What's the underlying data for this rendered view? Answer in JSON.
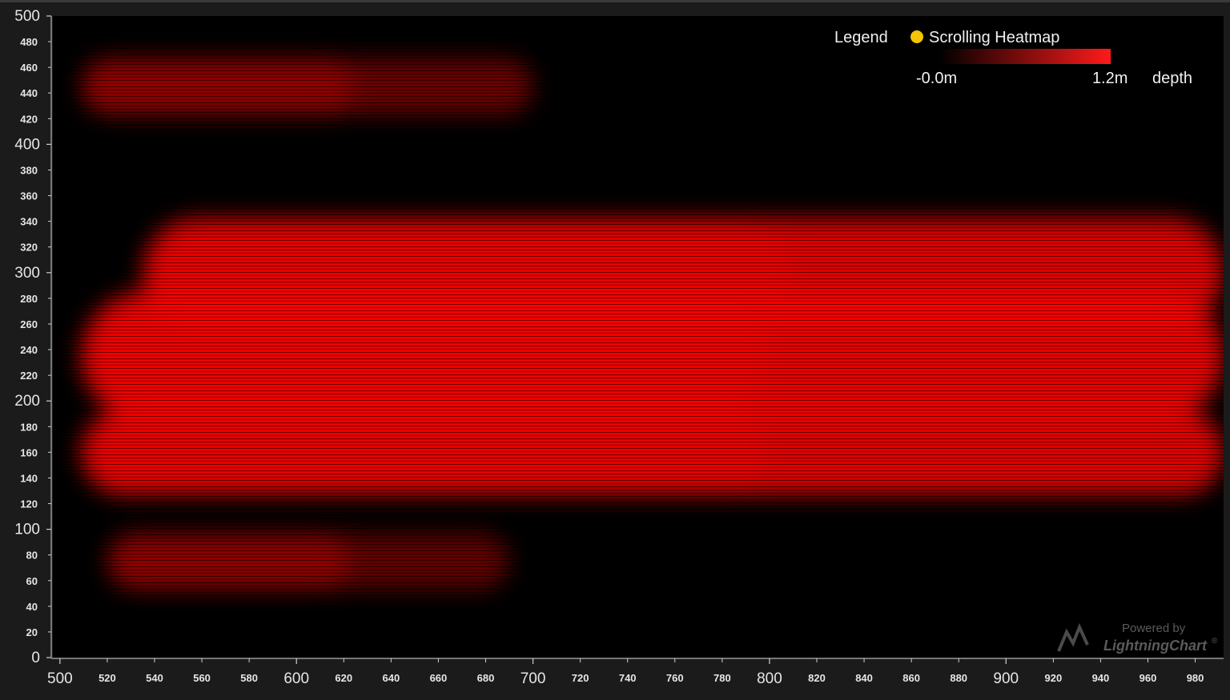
{
  "chart_data": {
    "type": "heatmap",
    "title": "",
    "xlabel": "",
    "ylabel": "",
    "xlim": [
      497,
      992
    ],
    "ylim": [
      0,
      500
    ],
    "x_ticks_major": [
      500,
      600,
      700,
      800,
      900
    ],
    "x_ticks_minor": [
      520,
      540,
      560,
      580,
      620,
      640,
      660,
      680,
      720,
      740,
      760,
      780,
      820,
      840,
      860,
      880,
      920,
      940,
      960,
      980
    ],
    "y_ticks_major": [
      0,
      100,
      200,
      300,
      400,
      500
    ],
    "y_ticks_minor": [
      20,
      40,
      60,
      80,
      120,
      140,
      160,
      180,
      220,
      240,
      260,
      280,
      320,
      340,
      360,
      380,
      420,
      440,
      460,
      480
    ],
    "data_x_start": 509,
    "grid": false,
    "series_name": "Scrolling Heatmap",
    "value_unit": "depth",
    "value_range": [
      0.0,
      1.2
    ],
    "palette": {
      "min_color": "#000000",
      "max_color": "#ff0000"
    },
    "bands": [
      {
        "y": 445,
        "half_width": 22,
        "value": 0.9,
        "x_extent": [
          509,
          700
        ],
        "tail": 0.55
      },
      {
        "y": 300,
        "half_width": 42,
        "value": 1.05,
        "x_extent": [
          535,
          992
        ],
        "tail": 1.0
      },
      {
        "y": 235,
        "half_width": 50,
        "value": 1.15,
        "x_extent": [
          509,
          992
        ],
        "tail": 0.95
      },
      {
        "y": 160,
        "half_width": 33,
        "value": 1.05,
        "x_extent": [
          509,
          992
        ],
        "tail": 1.0
      },
      {
        "y": 75,
        "half_width": 22,
        "value": 1.0,
        "x_extent": [
          520,
          690
        ],
        "tail": 0.45
      }
    ]
  },
  "legend": {
    "title": "Legend",
    "series_label": "Scrolling Heatmap",
    "marker_color": "#f2c500",
    "min_label": "-0.0m",
    "max_label": "1.2m",
    "unit_label": "depth",
    "gradient_start": "#000000",
    "gradient_end": "#ff1a1a"
  },
  "watermark": {
    "line1": "Powered by",
    "line2": "LightningChart",
    "mark": "®"
  },
  "colors": {
    "background": "#1b1b1b",
    "plot_background": "#000000",
    "axis": "#d0d0d0",
    "heat": "#ff0000"
  }
}
